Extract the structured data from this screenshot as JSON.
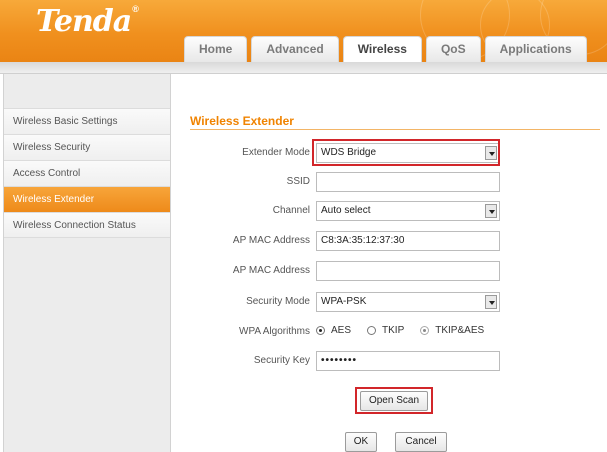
{
  "brand": {
    "logo_text": "Tenda",
    "logo_mark": "®"
  },
  "tabs": [
    {
      "label": "Home",
      "active": false
    },
    {
      "label": "Advanced",
      "active": false
    },
    {
      "label": "Wireless",
      "active": true
    },
    {
      "label": "QoS",
      "active": false
    },
    {
      "label": "Applications",
      "active": false
    }
  ],
  "sidebar": {
    "items": [
      {
        "label": "Wireless Basic Settings",
        "active": false
      },
      {
        "label": "Wireless Security",
        "active": false
      },
      {
        "label": "Access Control",
        "active": false
      },
      {
        "label": "Wireless Extender",
        "active": true
      },
      {
        "label": "Wireless Connection Status",
        "active": false
      }
    ]
  },
  "form": {
    "title": "Wireless Extender",
    "extender_mode": {
      "label": "Extender Mode",
      "value": "WDS Bridge"
    },
    "ssid": {
      "label": "SSID",
      "value": ""
    },
    "channel": {
      "label": "Channel",
      "value": "Auto select"
    },
    "ap_mac_1": {
      "label": "AP MAC Address",
      "value": "C8:3A:35:12:37:30"
    },
    "ap_mac_2": {
      "label": "AP MAC Address",
      "value": ""
    },
    "security_mode": {
      "label": "Security Mode",
      "value": "WPA-PSK"
    },
    "wpa_algorithms": {
      "label": "WPA Algorithms",
      "options": [
        {
          "label": "AES",
          "selected": true
        },
        {
          "label": "TKIP",
          "selected": false
        },
        {
          "label": "TKIP&AES",
          "selected": false
        }
      ]
    },
    "security_key": {
      "label": "Security Key",
      "value": "••••••••"
    }
  },
  "buttons": {
    "open_scan": "Open Scan",
    "ok": "OK",
    "cancel": "Cancel"
  },
  "colors": {
    "accent": "#f08300",
    "highlight": "#d2262a"
  }
}
